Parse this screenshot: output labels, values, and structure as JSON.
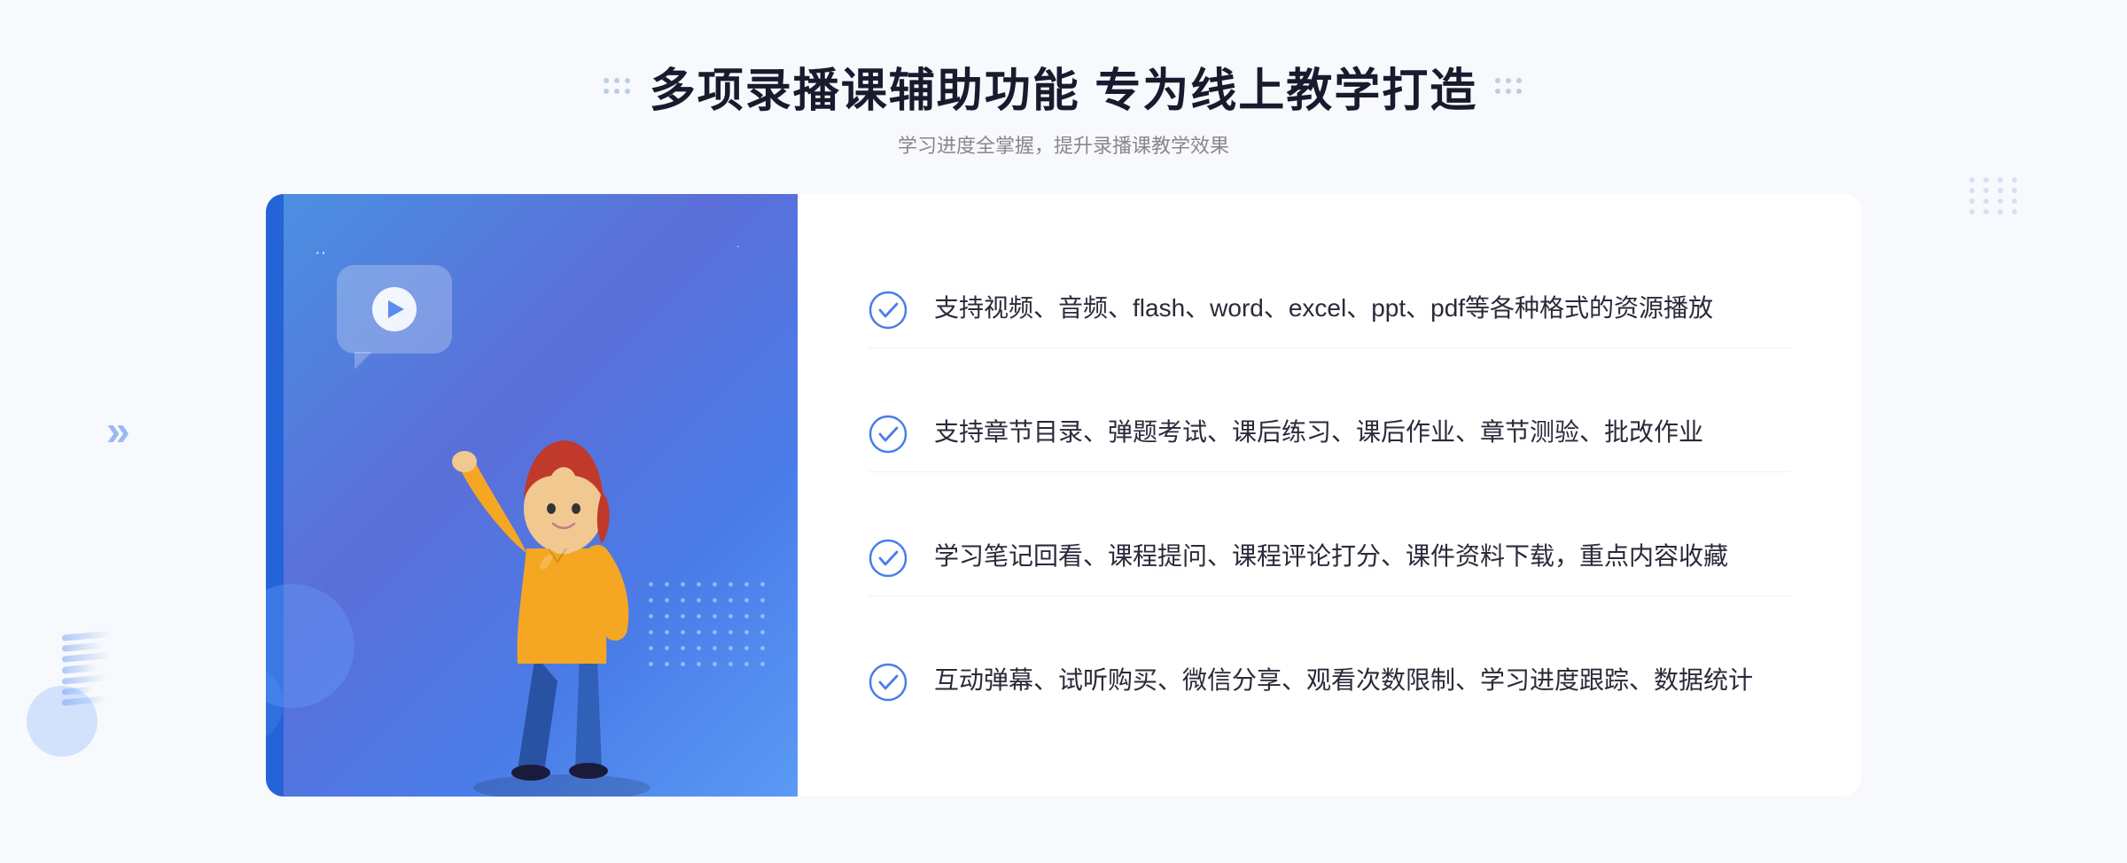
{
  "header": {
    "title": "多项录播课辅助功能 专为线上教学打造",
    "subtitle": "学习进度全掌握，提升录播课教学效果"
  },
  "features": [
    {
      "id": "feature-1",
      "text": "支持视频、音频、flash、word、excel、ppt、pdf等各种格式的资源播放"
    },
    {
      "id": "feature-2",
      "text": "支持章节目录、弹题考试、课后练习、课后作业、章节测验、批改作业"
    },
    {
      "id": "feature-3",
      "text": "学习笔记回看、课程提问、课程评论打分、课件资料下载，重点内容收藏"
    },
    {
      "id": "feature-4",
      "text": "互动弹幕、试听购买、微信分享、观看次数限制、学习进度跟踪、数据统计"
    }
  ],
  "icons": {
    "check": "check-circle-icon",
    "play": "play-icon",
    "left_chevron": "«",
    "left_chevron_display": "»"
  },
  "colors": {
    "primary_blue": "#4a7ee8",
    "dark_blue": "#2563d8",
    "light_bg": "#f7f9fc",
    "text_dark": "#2a2a3a",
    "text_gray": "#888888"
  }
}
